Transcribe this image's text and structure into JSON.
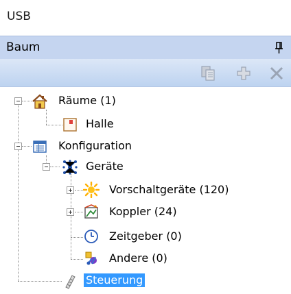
{
  "window": {
    "title": "USB"
  },
  "panel": {
    "title": "Baum",
    "pin_icon": "pin-icon"
  },
  "toolbar": {
    "buttons": [
      "copy-icon",
      "add-icon",
      "delete-icon"
    ],
    "disabled_color": "#9aa4b4"
  },
  "tree": {
    "raeume": "Räume (1)",
    "halle": "Halle",
    "konfiguration": "Konfiguration",
    "geraete": "Geräte",
    "vorschaltgeraete": "Vorschaltgeräte (120)",
    "koppler": "Koppler (24)",
    "zeitgeber": "Zeitgeber (0)",
    "andere": "Andere (0)",
    "steuerung": "Steuerung",
    "selected": "Steuerung",
    "selection_color": "#3399ff"
  }
}
